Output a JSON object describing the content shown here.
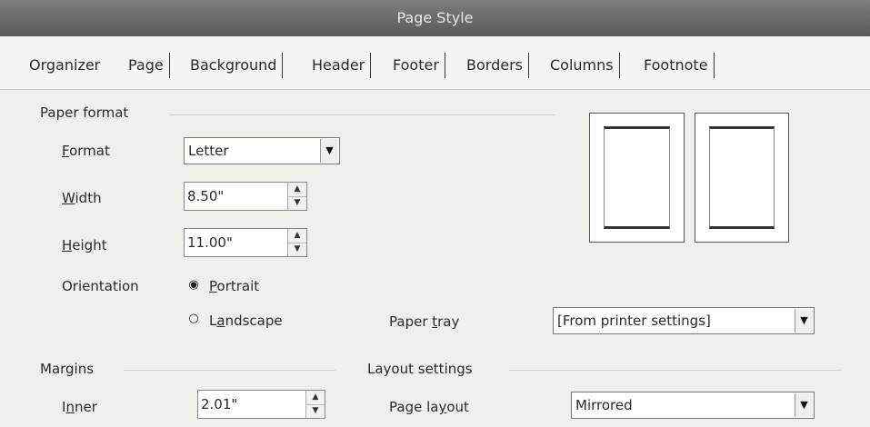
{
  "window": {
    "title": "Page Style"
  },
  "tabs": [
    {
      "label": "Organizer",
      "active": false
    },
    {
      "label": "Page",
      "active": true
    },
    {
      "label": "Background",
      "active": false
    },
    {
      "label": "Header",
      "active": false
    },
    {
      "label": "Footer",
      "active": false
    },
    {
      "label": "Borders",
      "active": false
    },
    {
      "label": "Columns",
      "active": false
    },
    {
      "label": "Footnote",
      "active": false
    }
  ],
  "paper_format": {
    "group_label": "Paper format",
    "format": {
      "label_first": "F",
      "label_rest": "ormat",
      "value": "Letter"
    },
    "width": {
      "label_first": "W",
      "label_rest": "idth",
      "value": "8.50\""
    },
    "height": {
      "label_first": "H",
      "label_rest": "eight",
      "value": "11.00\""
    },
    "orientation": {
      "label": "Orientation",
      "portrait": {
        "label_first": "P",
        "label_rest": "ortrait",
        "selected": true
      },
      "landscape": {
        "label_pre": "L",
        "label_u": "a",
        "label_rest": "ndscape",
        "selected": false
      }
    },
    "paper_tray": {
      "label_pre": "Paper ",
      "label_u": "t",
      "label_rest": "ray",
      "value": "[From printer settings]"
    }
  },
  "margins": {
    "group_label": "Margins",
    "inner": {
      "label_pre": "I",
      "label_u": "n",
      "label_rest": "ner",
      "value": "2.01\""
    }
  },
  "layout_settings": {
    "group_label": "Layout settings",
    "page_layout": {
      "label_pre": "Page la",
      "label_u": "y",
      "label_rest": "out",
      "value": "Mirrored"
    }
  },
  "icons": {
    "dropdown": "chevron-down-icon",
    "spin_up": "arrow-up-icon",
    "spin_down": "arrow-down-icon"
  }
}
